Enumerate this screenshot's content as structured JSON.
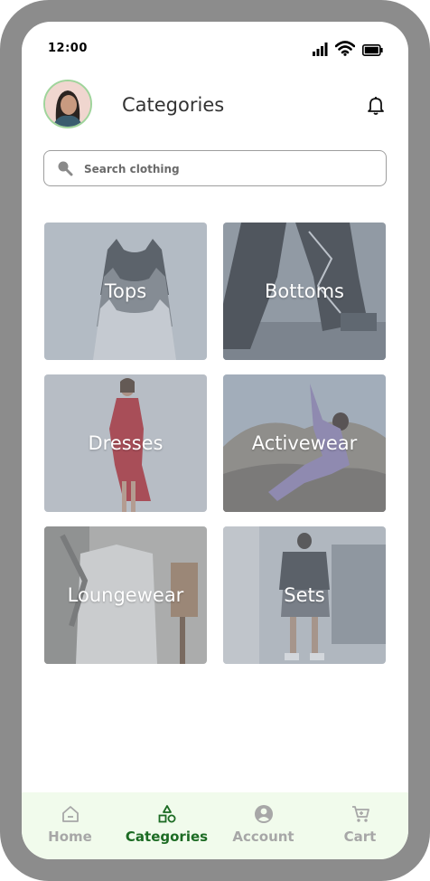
{
  "status_bar": {
    "time": "12:00"
  },
  "header": {
    "title": "Categories"
  },
  "search": {
    "placeholder": "Search clothing"
  },
  "categories": [
    {
      "label": "Tops"
    },
    {
      "label": "Bottoms"
    },
    {
      "label": "Dresses"
    },
    {
      "label": "Activewear"
    },
    {
      "label": "Loungewear"
    },
    {
      "label": "Sets"
    }
  ],
  "bottom_nav": {
    "items": [
      {
        "label": "Home",
        "icon": "home-icon",
        "active": false
      },
      {
        "label": "Categories",
        "icon": "shapes-icon",
        "active": true
      },
      {
        "label": "Account",
        "icon": "account-icon",
        "active": false
      },
      {
        "label": "Cart",
        "icon": "cart-icon",
        "active": false
      }
    ]
  },
  "colors": {
    "accent": "#1c6b23",
    "nav_background": "#f1fbec",
    "inactive": "#a7a7a7",
    "frame": "#8c8c8c"
  }
}
